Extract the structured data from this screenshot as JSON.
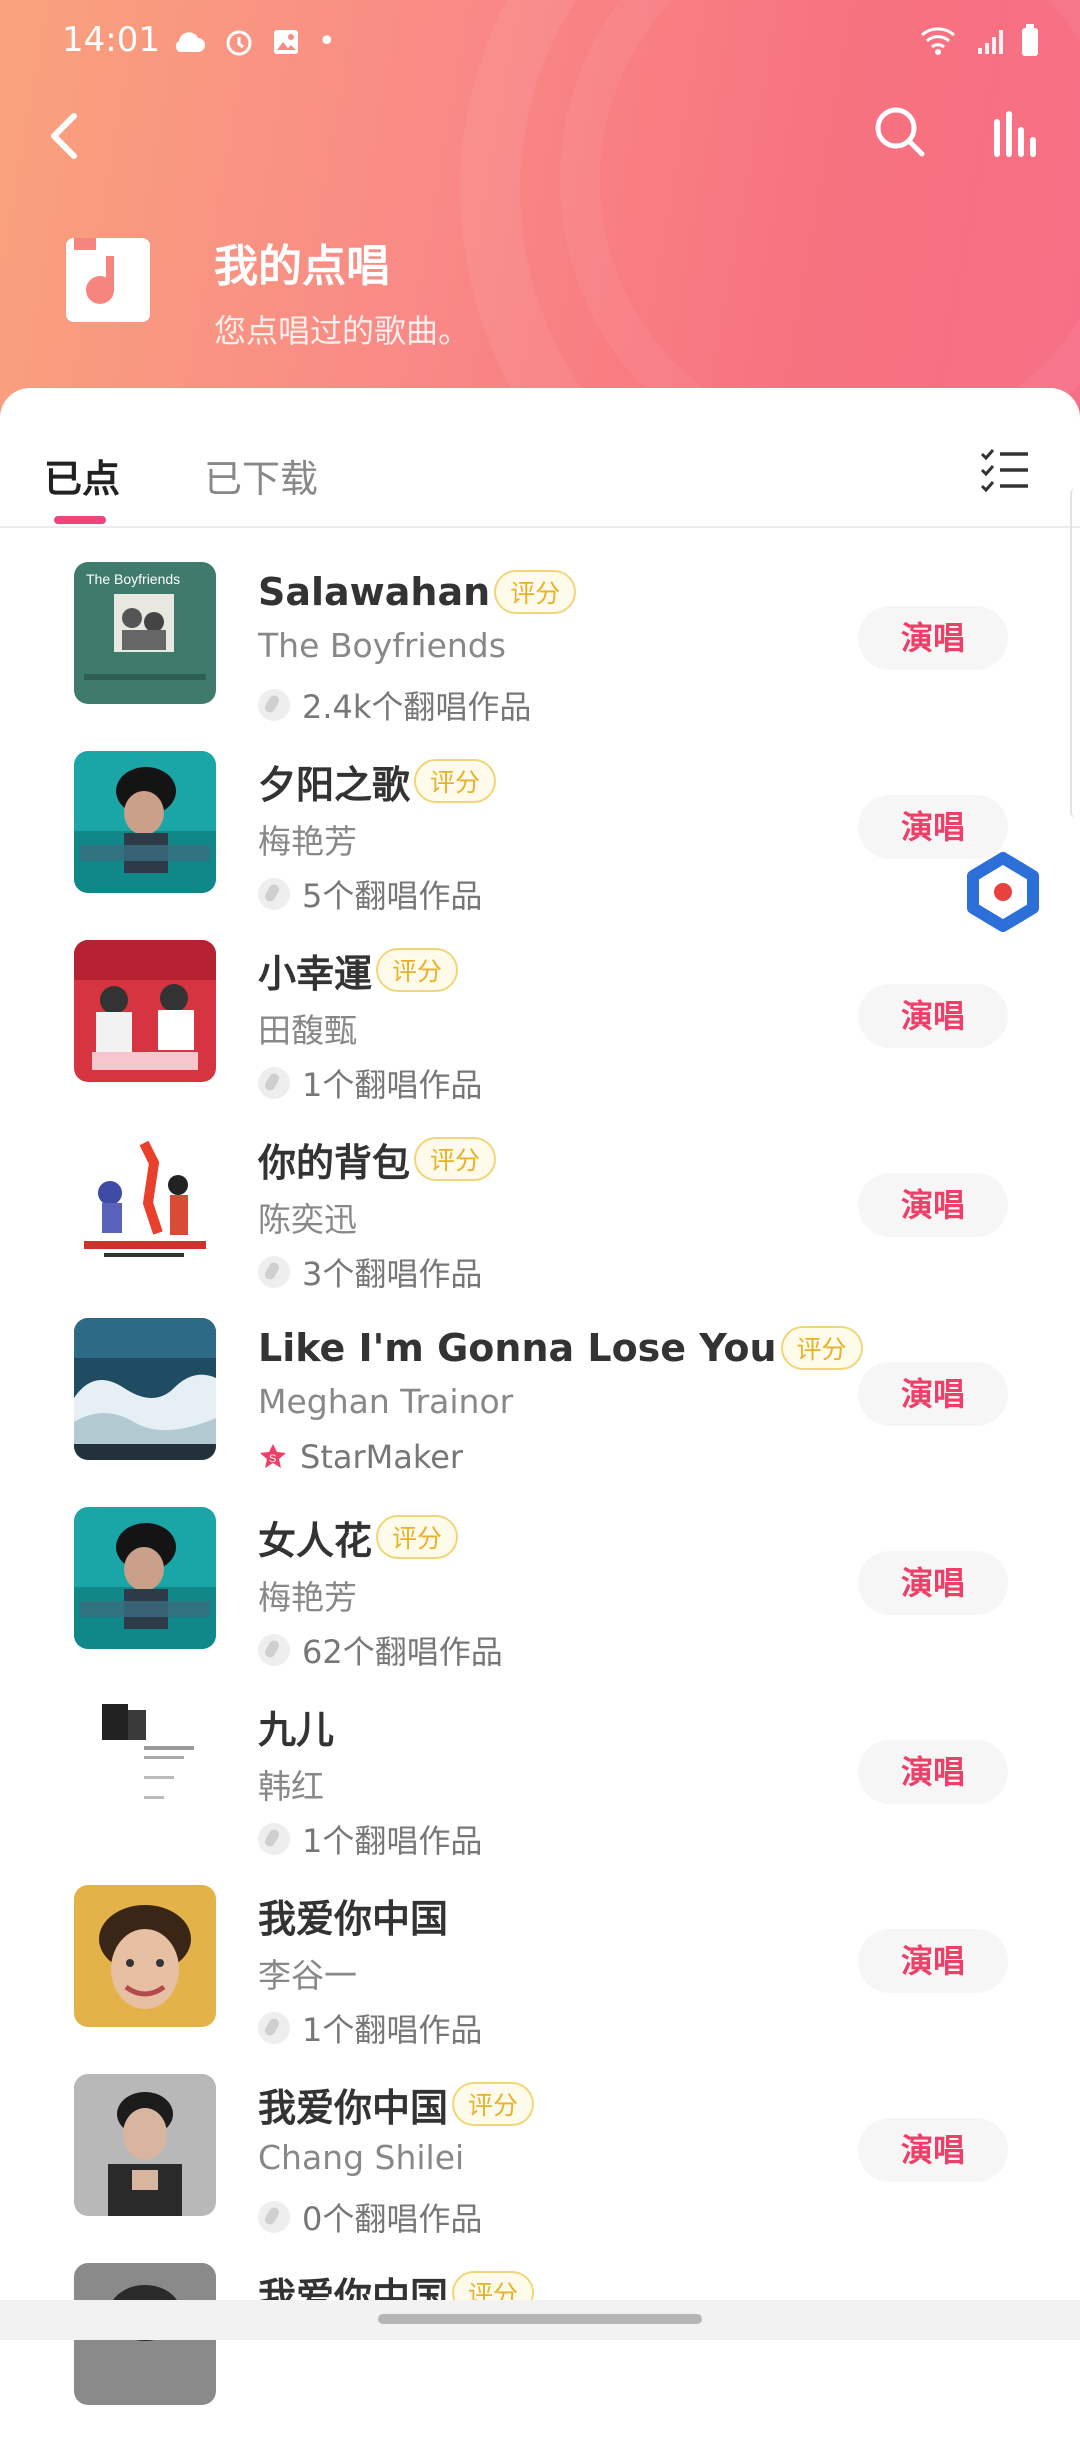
{
  "status": {
    "time": "14:01",
    "dot": "•"
  },
  "header": {
    "title": "我的点唱",
    "subtitle": "您点唱过的歌曲。"
  },
  "tabs": {
    "active": "已点",
    "inactive": "已下载"
  },
  "sing_label": "演唱",
  "badge_label": "评分",
  "accent": "#ee3f68",
  "songs": [
    {
      "title": "Salawahan",
      "artist": "The Boyfriends",
      "meta": "2.4k个翻唱作品",
      "badge": true,
      "thumb": "the-boyfriends-cover"
    },
    {
      "title": "夕阳之歌",
      "artist": "梅艳芳",
      "meta": "5个翻唱作品",
      "badge": true,
      "thumb": "anita-mui-cover"
    },
    {
      "title": "小幸運",
      "artist": "田馥甄",
      "meta": "1个翻唱作品",
      "badge": true,
      "thumb": "our-times-cover"
    },
    {
      "title": "你的背包",
      "artist": "陈奕迅",
      "meta": "3个翻唱作品",
      "badge": true,
      "thumb": "great-eason-cover"
    },
    {
      "title": "Like I'm Gonna Lose You",
      "artist": "Meghan Trainor",
      "meta": "StarMaker",
      "badge": true,
      "thumb": "wave-cover"
    },
    {
      "title": "女人花",
      "artist": "梅艳芳",
      "meta": "62个翻唱作品",
      "badge": true,
      "thumb": "anita-mui-cover"
    },
    {
      "title": "九儿",
      "artist": "韩红",
      "meta": "1个翻唱作品",
      "badge": false,
      "thumb": "document-cover"
    },
    {
      "title": "我爱你中国",
      "artist": "李谷一",
      "meta": "1个翻唱作品",
      "badge": false,
      "thumb": "portrait-cover"
    },
    {
      "title": "我爱你中国",
      "artist": "Chang Shilei",
      "meta": "0个翻唱作品",
      "badge": true,
      "thumb": "man-cover"
    },
    {
      "title": "我爱你中国",
      "artist": "",
      "meta": "",
      "badge": true,
      "thumb": "bw-cover"
    }
  ]
}
